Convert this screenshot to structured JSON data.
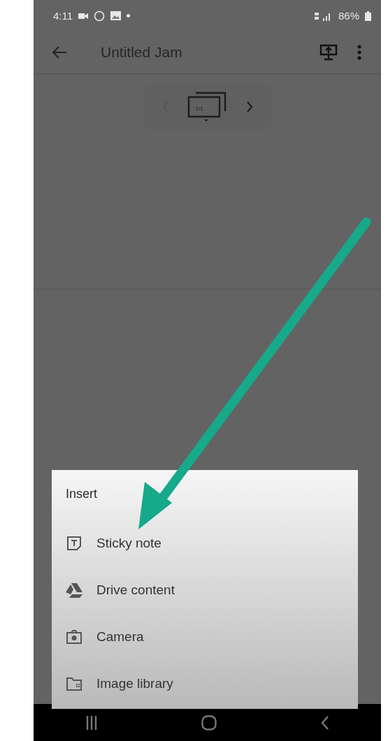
{
  "status_bar": {
    "time": "4:11",
    "battery": "86%"
  },
  "app_bar": {
    "title": "Untitled Jam"
  },
  "frame_nav": {
    "page": "1/1"
  },
  "insert_menu": {
    "title": "Insert",
    "items": [
      {
        "label": "Sticky note",
        "kind": "note"
      },
      {
        "label": "Drive content",
        "kind": "drive"
      },
      {
        "label": "Camera",
        "kind": "camera"
      },
      {
        "label": "Image library",
        "kind": "library"
      }
    ]
  }
}
